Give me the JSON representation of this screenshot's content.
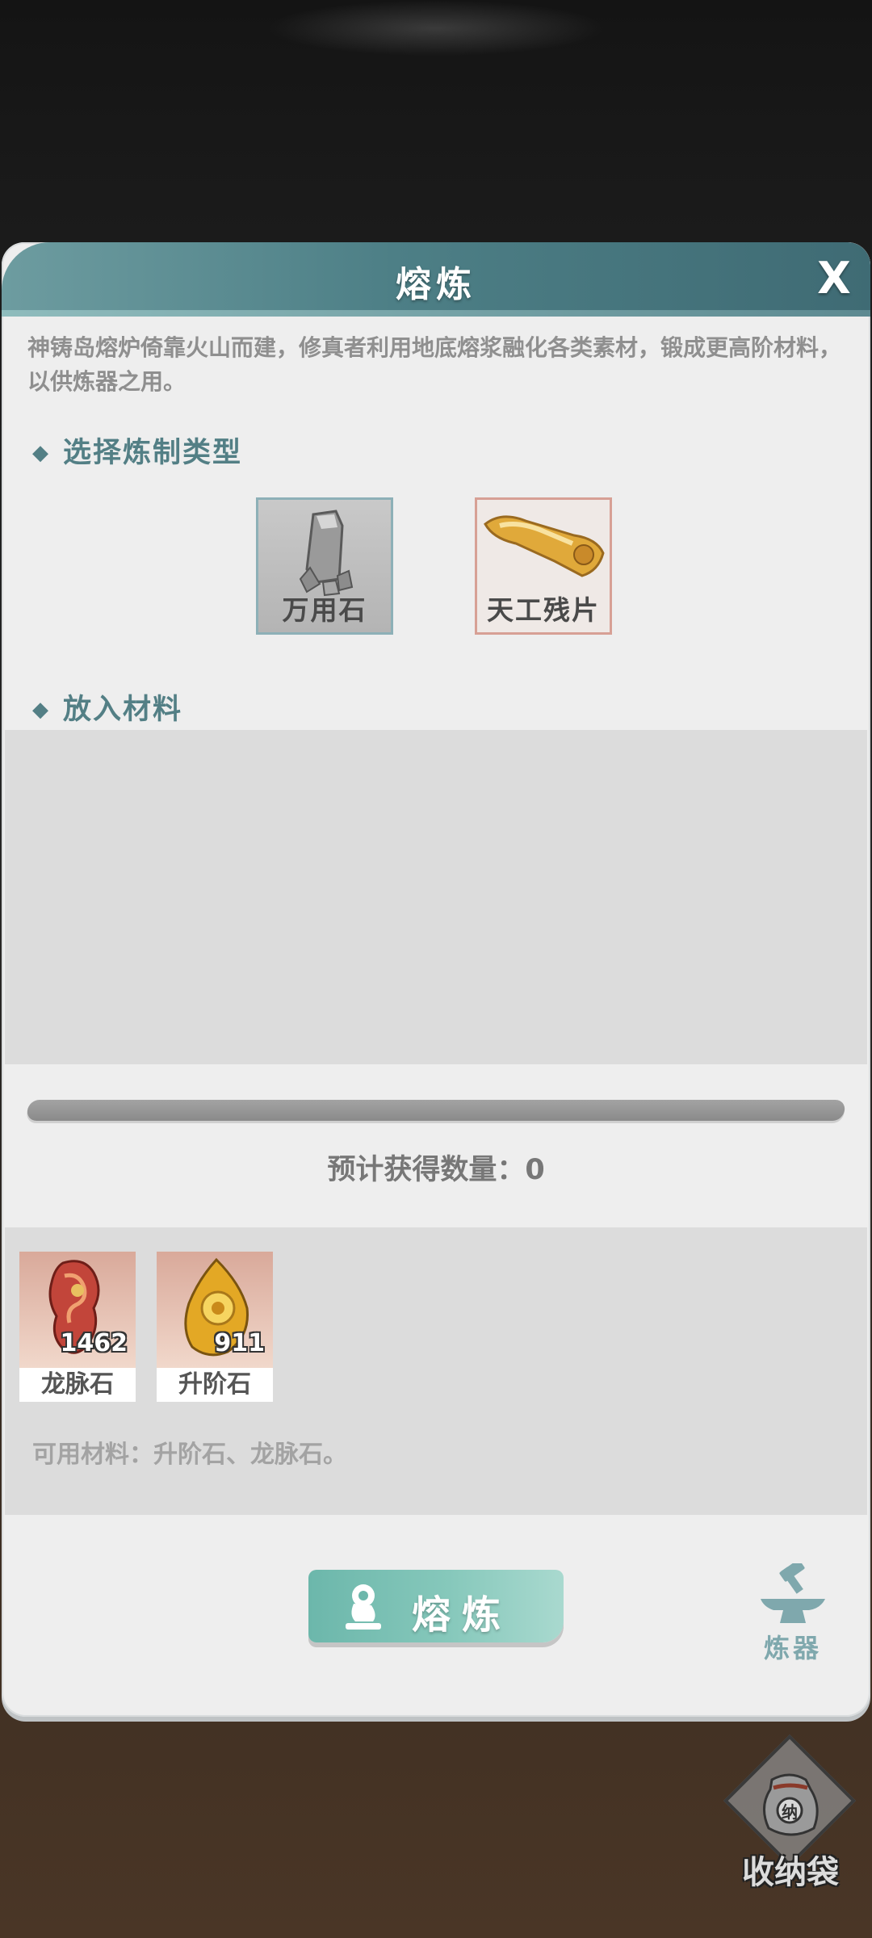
{
  "dialog": {
    "title": "熔炼",
    "close_label": "X",
    "description": "神铸岛熔炉倚靠火山而建，修真者利用地底熔浆融化各类素材，锻成更高阶材料，以供炼器之用。"
  },
  "type_section": {
    "heading": "选择炼制类型",
    "types": [
      {
        "label": "万用石",
        "icon": "grey-stone-icon"
      },
      {
        "label": "天工残片",
        "icon": "golden-fragment-icon"
      }
    ]
  },
  "material_section": {
    "heading": "放入材料"
  },
  "progress": {
    "fraction": 0
  },
  "expected_label": "预计获得数量：",
  "expected_value": "0",
  "inventory": {
    "items": [
      {
        "name": "龙脉石",
        "quantity": "1462",
        "icon": "dragon-vein-stone-icon"
      },
      {
        "name": "升阶石",
        "quantity": "911",
        "icon": "ascension-stone-icon"
      }
    ],
    "available_text": "可用材料：升阶石、龙脉石。"
  },
  "actions": {
    "smelt_label": "熔炼",
    "forge_label": "炼器"
  },
  "bag": {
    "label": "收纳袋",
    "badge": "纳"
  },
  "colors": {
    "title_bar": "#4d7f86",
    "accent": "#6cb7ab",
    "section_heading": "#537f85"
  }
}
